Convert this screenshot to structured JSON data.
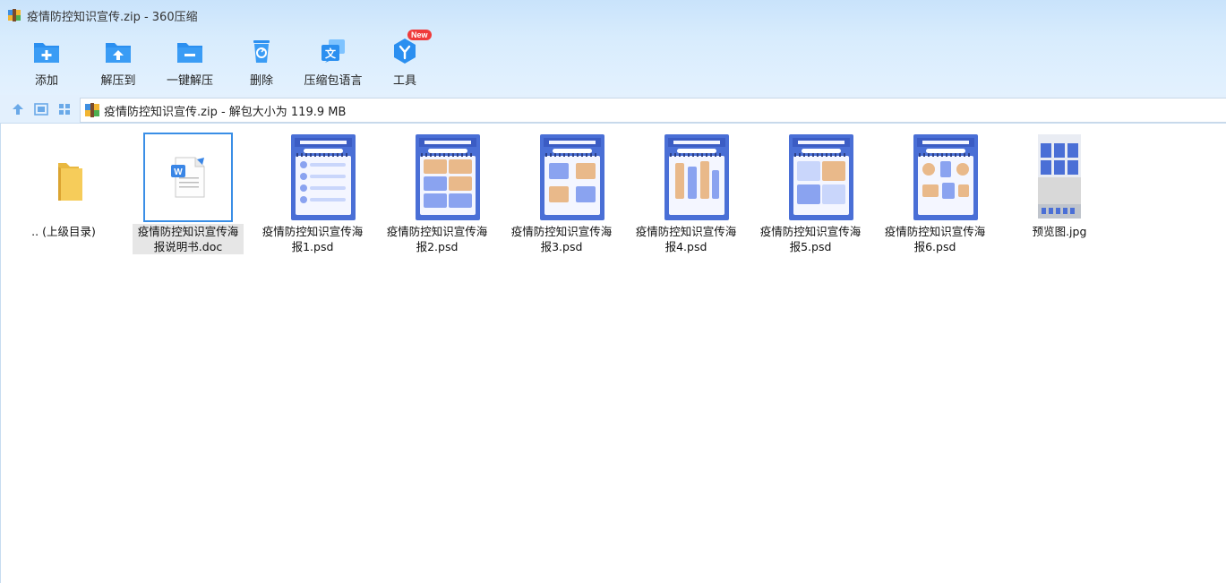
{
  "window": {
    "title": "疫情防控知识宣传.zip - 360压缩"
  },
  "toolbar": {
    "items": [
      {
        "label": "添加",
        "icon": "add-icon"
      },
      {
        "label": "解压到",
        "icon": "extract-to-icon"
      },
      {
        "label": "一键解压",
        "icon": "one-click-extract-icon"
      },
      {
        "label": "删除",
        "icon": "delete-icon"
      },
      {
        "label": "压缩包语言",
        "icon": "language-icon"
      },
      {
        "label": "工具",
        "icon": "tools-icon",
        "badge": "New"
      }
    ]
  },
  "navbar": {
    "address": "疫情防控知识宣传.zip - 解包大小为 119.9 MB"
  },
  "files": [
    {
      "name": ".. (上级目录)",
      "type": "parent-folder"
    },
    {
      "name": "疫情防控知识宣传海报说明书.doc",
      "type": "doc",
      "selected": true
    },
    {
      "name": "疫情防控知识宣传海报1.psd",
      "type": "psd"
    },
    {
      "name": "疫情防控知识宣传海报2.psd",
      "type": "psd"
    },
    {
      "name": "疫情防控知识宣传海报3.psd",
      "type": "psd"
    },
    {
      "name": "疫情防控知识宣传海报4.psd",
      "type": "psd"
    },
    {
      "name": "疫情防控知识宣传海报5.psd",
      "type": "psd"
    },
    {
      "name": "疫情防控知识宣传海报6.psd",
      "type": "psd"
    },
    {
      "name": "预览图.jpg",
      "type": "jpg"
    }
  ],
  "colors": {
    "accent": "#2b8ff0",
    "poster_blue": "#4a6fd6",
    "badge_red": "#ef3b3b",
    "folder_yellow": "#f6cc5a"
  }
}
